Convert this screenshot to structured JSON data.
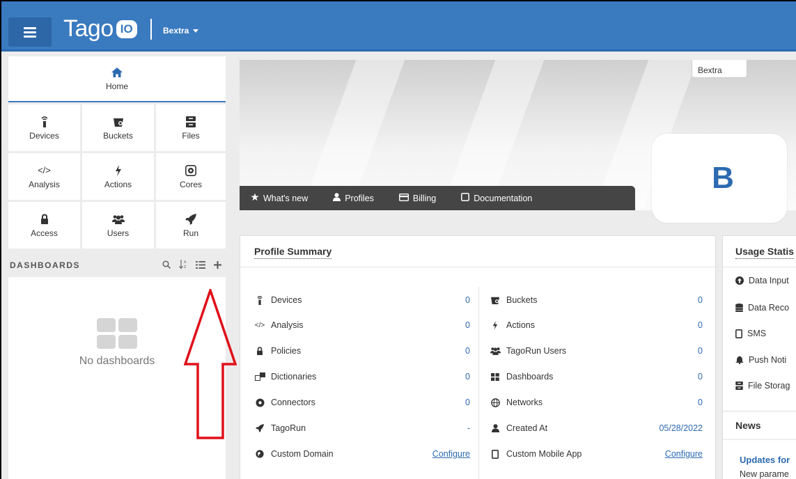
{
  "app": {
    "logo_text": "Tago",
    "logo_badge": "IO",
    "account": "Bextra"
  },
  "sidebar": {
    "home": {
      "label": "Home",
      "icon": "home-icon"
    },
    "tiles": [
      {
        "label": "Devices",
        "icon": "device-icon"
      },
      {
        "label": "Buckets",
        "icon": "bucket-icon"
      },
      {
        "label": "Files",
        "icon": "files-icon"
      },
      {
        "label": "Analysis",
        "icon": "code-icon"
      },
      {
        "label": "Actions",
        "icon": "bolt-icon"
      },
      {
        "label": "Cores",
        "icon": "cores-icon"
      },
      {
        "label": "Access",
        "icon": "lock-icon"
      },
      {
        "label": "Users",
        "icon": "users-icon"
      },
      {
        "label": "Run",
        "icon": "rocket-icon"
      }
    ],
    "dashboards": {
      "title": "DASHBOARDS",
      "empty_text": "No dashboards"
    }
  },
  "banner": {
    "tab_label": "Bextra",
    "avatar_letter": "B",
    "quick_links": [
      {
        "label": "What's new",
        "icon": "star-icon"
      },
      {
        "label": "Profiles",
        "icon": "user-icon"
      },
      {
        "label": "Billing",
        "icon": "credit-card-icon"
      },
      {
        "label": "Documentation",
        "icon": "book-icon"
      }
    ]
  },
  "profile_summary": {
    "title": "Profile Summary",
    "left": [
      {
        "label": "Devices",
        "value": "0",
        "icon": "device-icon"
      },
      {
        "label": "Analysis",
        "value": "0",
        "icon": "code-icon"
      },
      {
        "label": "Policies",
        "value": "0",
        "icon": "lock-icon"
      },
      {
        "label": "Dictionaries",
        "value": "0",
        "icon": "dictionary-icon"
      },
      {
        "label": "Connectors",
        "value": "0",
        "icon": "connector-icon"
      },
      {
        "label": "TagoRun",
        "value": "-",
        "icon": "rocket-icon"
      },
      {
        "label": "Custom Domain",
        "value": "Configure",
        "icon": "globe-icon"
      }
    ],
    "right": [
      {
        "label": "Buckets",
        "value": "0",
        "icon": "bucket-icon"
      },
      {
        "label": "Actions",
        "value": "0",
        "icon": "bolt-icon"
      },
      {
        "label": "TagoRun Users",
        "value": "0",
        "icon": "users-icon"
      },
      {
        "label": "Dashboards",
        "value": "0",
        "icon": "dashboard-icon"
      },
      {
        "label": "Networks",
        "value": "0",
        "icon": "network-icon"
      },
      {
        "label": "Created At",
        "value": "05/28/2022",
        "icon": "user-icon"
      },
      {
        "label": "Custom Mobile App",
        "value": "Configure",
        "icon": "mobile-icon"
      }
    ]
  },
  "usage": {
    "title": "Usage Statis",
    "rows": [
      {
        "label": "Data Input",
        "icon": "upload-icon"
      },
      {
        "label": "Data Reco",
        "icon": "database-icon"
      },
      {
        "label": "SMS",
        "icon": "mobile-icon"
      },
      {
        "label": "Push Noti",
        "icon": "bell-icon"
      },
      {
        "label": "File Storag",
        "icon": "files-icon"
      }
    ]
  },
  "news": {
    "title": "News",
    "headline": "Updates for",
    "text": "New parame"
  },
  "colors": {
    "topbar": "#3a7abf",
    "accent": "#2c6ab0",
    "quickbar": "#454545",
    "arrow": "#e0101a"
  }
}
